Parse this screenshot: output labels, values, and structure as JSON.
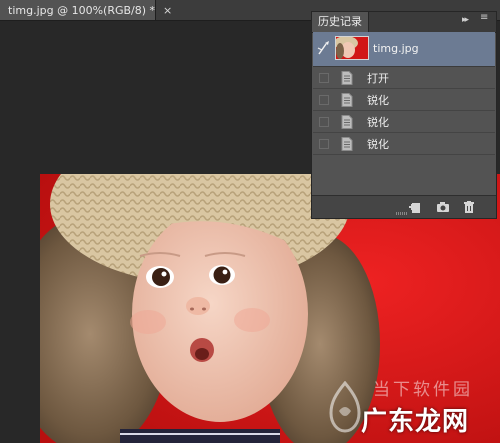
{
  "document": {
    "tab_title": "timg.jpg @ 100%(RGB/8) *",
    "close_glyph": "×"
  },
  "history_panel": {
    "tab_label": "历史记录",
    "collapse_glyph": "▸▸",
    "snapshot": {
      "label": "timg.jpg",
      "icon": "history-brush-icon"
    },
    "states": [
      {
        "label": "打开",
        "icon": "document-icon"
      },
      {
        "label": "锐化",
        "icon": "document-icon"
      },
      {
        "label": "锐化",
        "icon": "document-icon"
      },
      {
        "label": "锐化",
        "icon": "document-icon"
      }
    ],
    "footer_buttons": [
      "new-document-from-state-icon",
      "camera-icon",
      "trash-icon"
    ]
  },
  "watermark": {
    "top_text": "当下软件园",
    "bottom_text": "广东龙网"
  },
  "colors": {
    "canvas_bg": "#282828",
    "selected_row": "#6c7b93",
    "photo_red": "#d11616"
  }
}
